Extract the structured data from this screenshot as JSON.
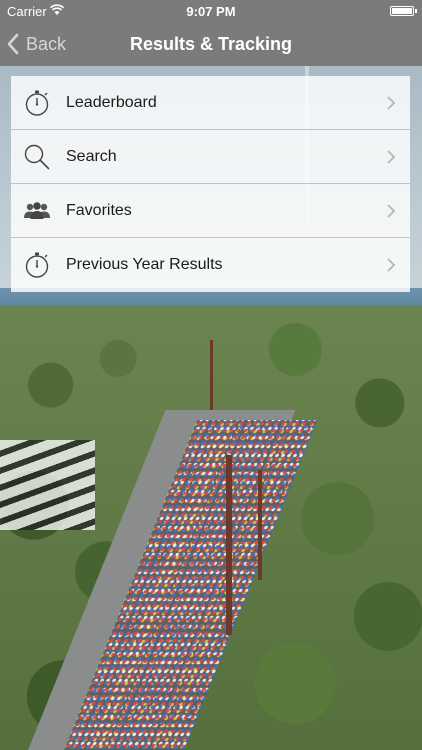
{
  "status_bar": {
    "carrier": "Carrier",
    "time": "9:07 PM"
  },
  "nav_bar": {
    "back_label": "Back",
    "title": "Results & Tracking"
  },
  "menu": {
    "items": [
      {
        "label": "Leaderboard",
        "icon": "stopwatch-icon"
      },
      {
        "label": "Search",
        "icon": "search-icon"
      },
      {
        "label": "Favorites",
        "icon": "people-icon"
      },
      {
        "label": "Previous Year Results",
        "icon": "stopwatch-icon"
      }
    ]
  },
  "colors": {
    "nav_bar": "#7b7b7b",
    "menu_background": "#ffffffd1",
    "label_text": "#1b1b1b",
    "chevron": "#b5b5b5"
  }
}
